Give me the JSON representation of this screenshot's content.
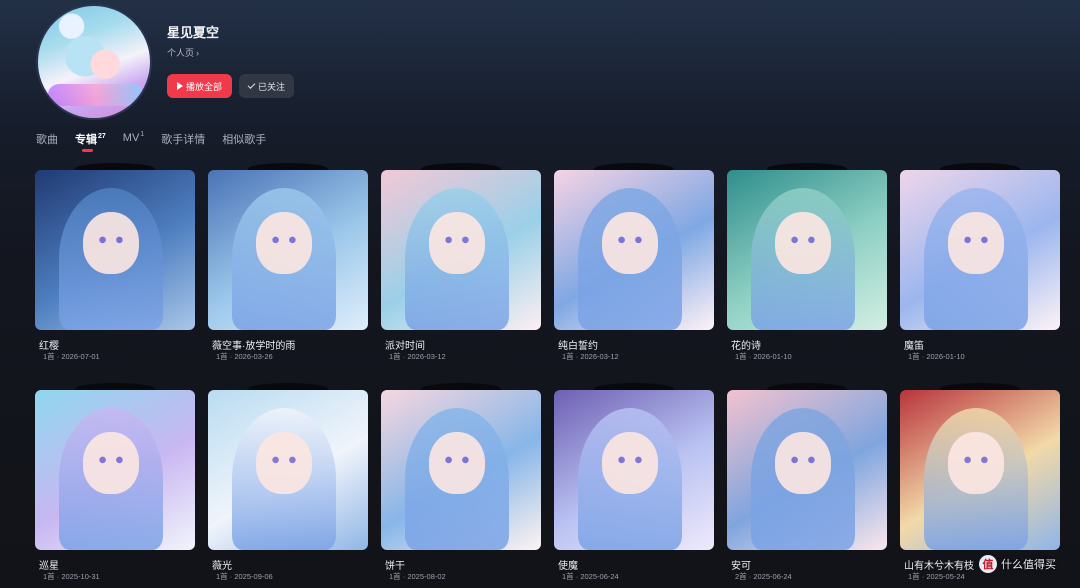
{
  "artist": {
    "name": "星见夏空",
    "profile_link": "个人页",
    "play_all_label": "播放全部",
    "follow_label": "已关注"
  },
  "tabs": [
    {
      "label": "歌曲",
      "count": ""
    },
    {
      "label": "专辑",
      "count": "27"
    },
    {
      "label": "MV",
      "count": "1"
    },
    {
      "label": "歌手详情",
      "count": ""
    },
    {
      "label": "相似歌手",
      "count": ""
    }
  ],
  "active_tab": "专辑",
  "accent_color": "#f0394a",
  "albums": [
    {
      "title": "红樱",
      "meta": "1首 · 2026-07-01",
      "palette": [
        "#203a73",
        "#4e7fc0",
        "#a9c6e8"
      ]
    },
    {
      "title": "薇空事·放学时的雨",
      "meta": "1首 · 2026-03-26",
      "palette": [
        "#4a73b6",
        "#9cc7ea",
        "#dfeefb"
      ]
    },
    {
      "title": "派对时间",
      "meta": "1首 · 2026-03-12",
      "palette": [
        "#f3c8d6",
        "#9ad0e8",
        "#fdeff2"
      ]
    },
    {
      "title": "纯白誓约",
      "meta": "1首 · 2026-03-12",
      "palette": [
        "#f6d3e4",
        "#7fa8e3",
        "#fff2f7"
      ]
    },
    {
      "title": "花的诗",
      "meta": "1首 · 2026-01-10",
      "palette": [
        "#2f8e8c",
        "#8fd0c4",
        "#d4efe4"
      ]
    },
    {
      "title": "魔笛",
      "meta": "1首 · 2026-01-10",
      "palette": [
        "#eed6ea",
        "#9bb6ee",
        "#fdf3f7"
      ]
    },
    {
      "title": "巡星",
      "meta": "1首 · 2025-10-31",
      "palette": [
        "#8fd7ee",
        "#c9b7f2",
        "#f1f4fb"
      ]
    },
    {
      "title": "薇光",
      "meta": "1首 · 2025-09-06",
      "palette": [
        "#b9dcf1",
        "#f0f4fb",
        "#8fb6e6"
      ]
    },
    {
      "title": "饼干",
      "meta": "1首 · 2025-08-02",
      "palette": [
        "#f6d7df",
        "#87b6e8",
        "#fff4f1"
      ]
    },
    {
      "title": "使魔",
      "meta": "1首 · 2025-06-24",
      "palette": [
        "#6e5fb3",
        "#b9c2f2",
        "#efe9fb"
      ]
    },
    {
      "title": "安可",
      "meta": "2首 · 2025-06-24",
      "palette": [
        "#f3c2cf",
        "#7fa5de",
        "#fbe7ec"
      ]
    },
    {
      "title": "山有木兮木有枝",
      "meta": "1首 · 2025-05-24",
      "palette": [
        "#b8343c",
        "#f2d9a8",
        "#8fb5e8"
      ]
    }
  ],
  "watermark": {
    "badge": "值",
    "text": "什么值得买"
  }
}
